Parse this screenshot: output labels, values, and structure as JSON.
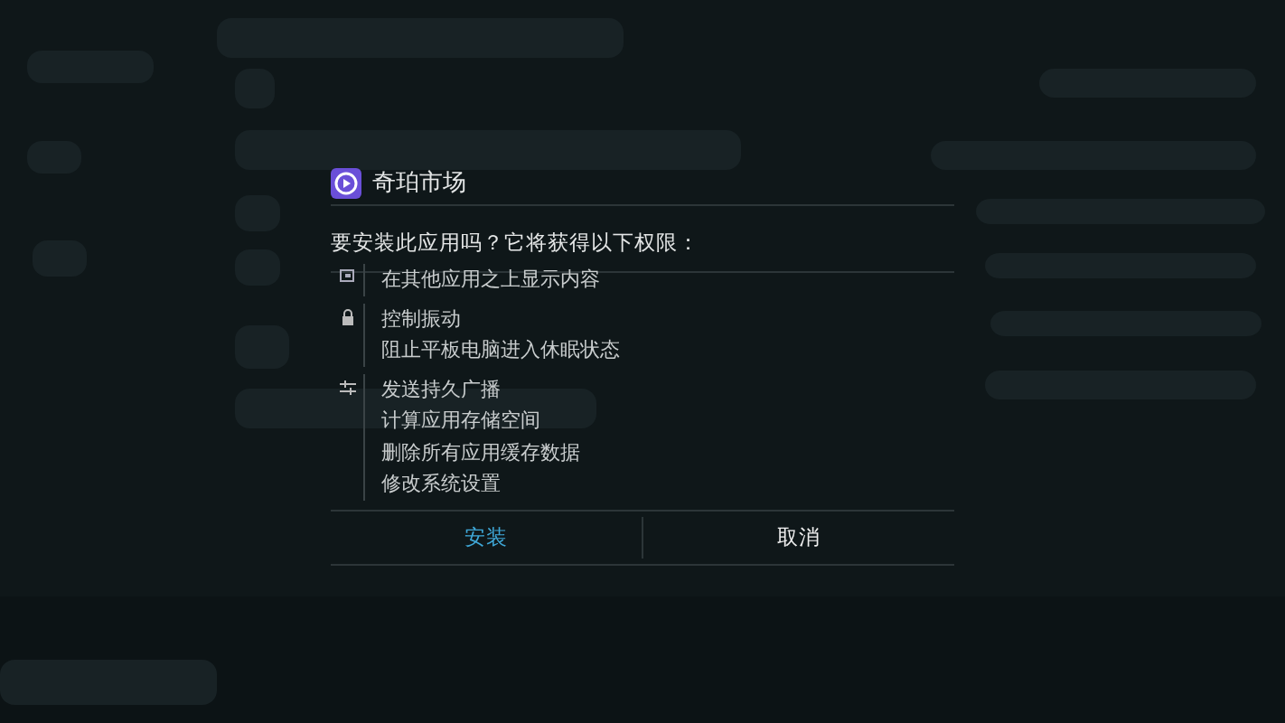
{
  "dialog": {
    "title": "奇珀市场",
    "message": "要安装此应用吗？它将获得以下权限：",
    "permission_groups": [
      {
        "kind": "window",
        "items": [
          "在其他应用之上显示内容"
        ]
      },
      {
        "kind": "lock",
        "items": [
          "控制振动",
          "阻止平板电脑进入休眠状态"
        ]
      },
      {
        "kind": "sliders",
        "items": [
          "发送持久广播",
          "计算应用存储空间",
          "删除所有应用缓存数据",
          "修改系统设置"
        ]
      }
    ],
    "buttons": [
      {
        "label": "安装",
        "kind": "primary"
      },
      {
        "label": "取消",
        "kind": "normal"
      }
    ]
  }
}
